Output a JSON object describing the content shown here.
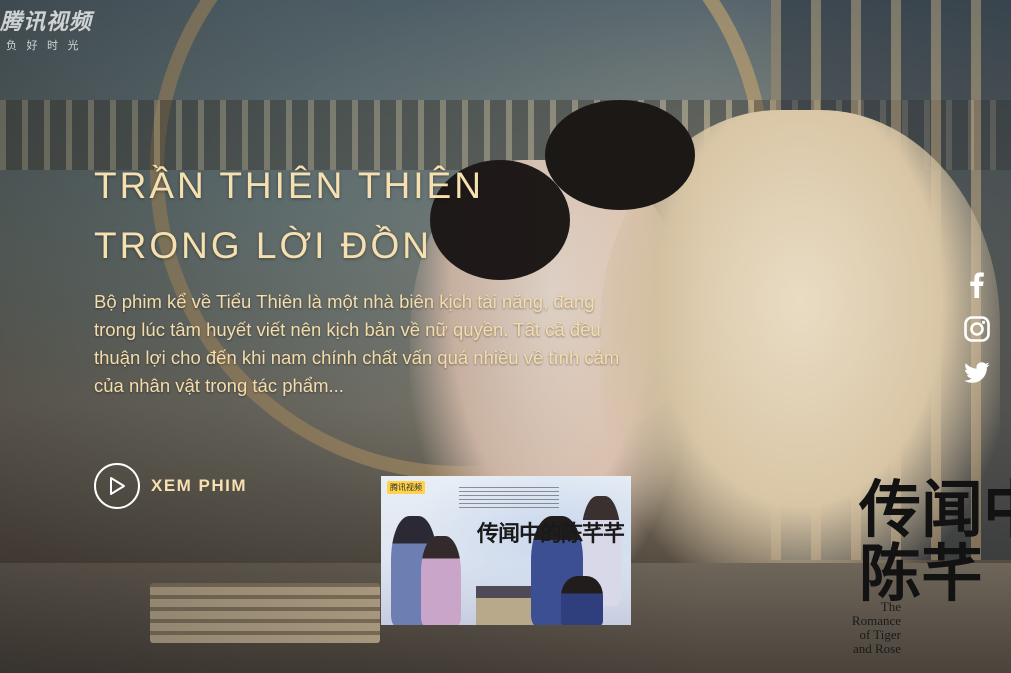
{
  "watermark": {
    "title": "腾讯视频",
    "subtitle": "负 好 时 光"
  },
  "hero": {
    "title_line1": "TRẦN THIÊN THIÊN",
    "title_line2": "TRONG LỜI ĐỒN",
    "description": "Bộ phim kể về Tiểu Thiên là một nhà biên kịch tài năng, đang trong lúc tâm huyết viết nên kịch bản về nữ quyền. Tất cả đều thuận lợi cho đến khi nam chính chất vấn quá nhiều về tình cảm của nhân vật trong tác phẩm..."
  },
  "watch_button": {
    "label": "XEM PHIM",
    "icon": "play-icon"
  },
  "socials": [
    {
      "name": "facebook",
      "icon": "facebook-icon"
    },
    {
      "name": "instagram",
      "icon": "instagram-icon"
    },
    {
      "name": "twitter",
      "icon": "twitter-icon"
    }
  ],
  "poster": {
    "logo": "腾讯视频",
    "title": "传闻中的陈芊芊"
  },
  "calligraphy": {
    "chars": "传闻中\n陈芊",
    "english_line1": "The Romance",
    "english_line2": "of Tiger",
    "english_line3": "and Rose"
  },
  "colors": {
    "accent_gold": "#f6e0b0",
    "text_gold": "#f4dcab",
    "icon_white": "#ffffff"
  }
}
